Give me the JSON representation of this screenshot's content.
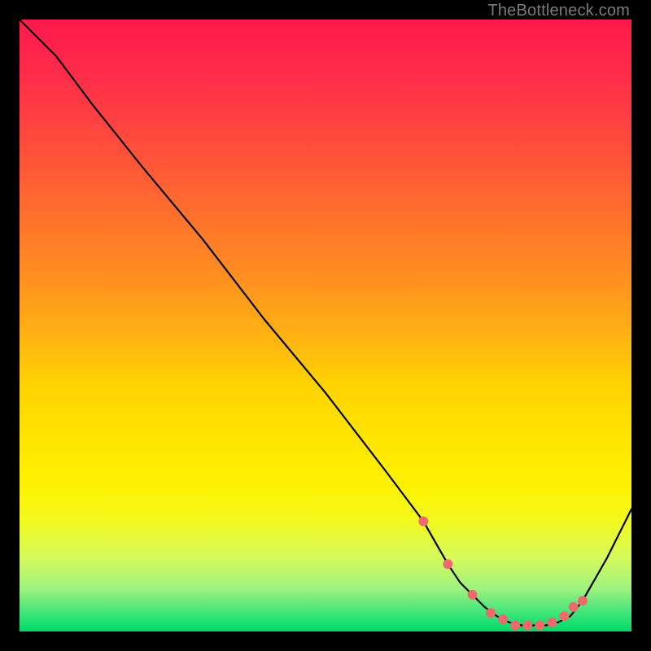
{
  "watermark": "TheBottleneck.com",
  "colors": {
    "page_bg": "#000000",
    "line": "#000000",
    "marker": "#ef6a6a",
    "gradient_top": "#ff1a4d",
    "gradient_bottom": "#00d86a"
  },
  "chart_data": {
    "type": "line",
    "title": "",
    "xlabel": "",
    "ylabel": "",
    "xlim": [
      0,
      100
    ],
    "ylim": [
      0,
      100
    ],
    "x": [
      0,
      6,
      12,
      20,
      30,
      40,
      50,
      60,
      66,
      70,
      72,
      74,
      76,
      78,
      80,
      82,
      84,
      86,
      88,
      90,
      92,
      96,
      100
    ],
    "values": [
      100,
      94,
      86,
      76,
      64,
      51,
      39,
      26,
      18,
      11,
      8,
      6,
      4,
      2.5,
      1.5,
      1,
      1,
      1,
      1.5,
      2.5,
      5,
      12,
      20
    ],
    "markers": {
      "x": [
        66,
        70,
        74,
        77,
        79,
        81,
        83,
        85,
        87,
        89,
        90.5,
        92
      ],
      "y": [
        18,
        11,
        6,
        3,
        2,
        1,
        1,
        1,
        1.5,
        2.5,
        4,
        5
      ]
    }
  }
}
